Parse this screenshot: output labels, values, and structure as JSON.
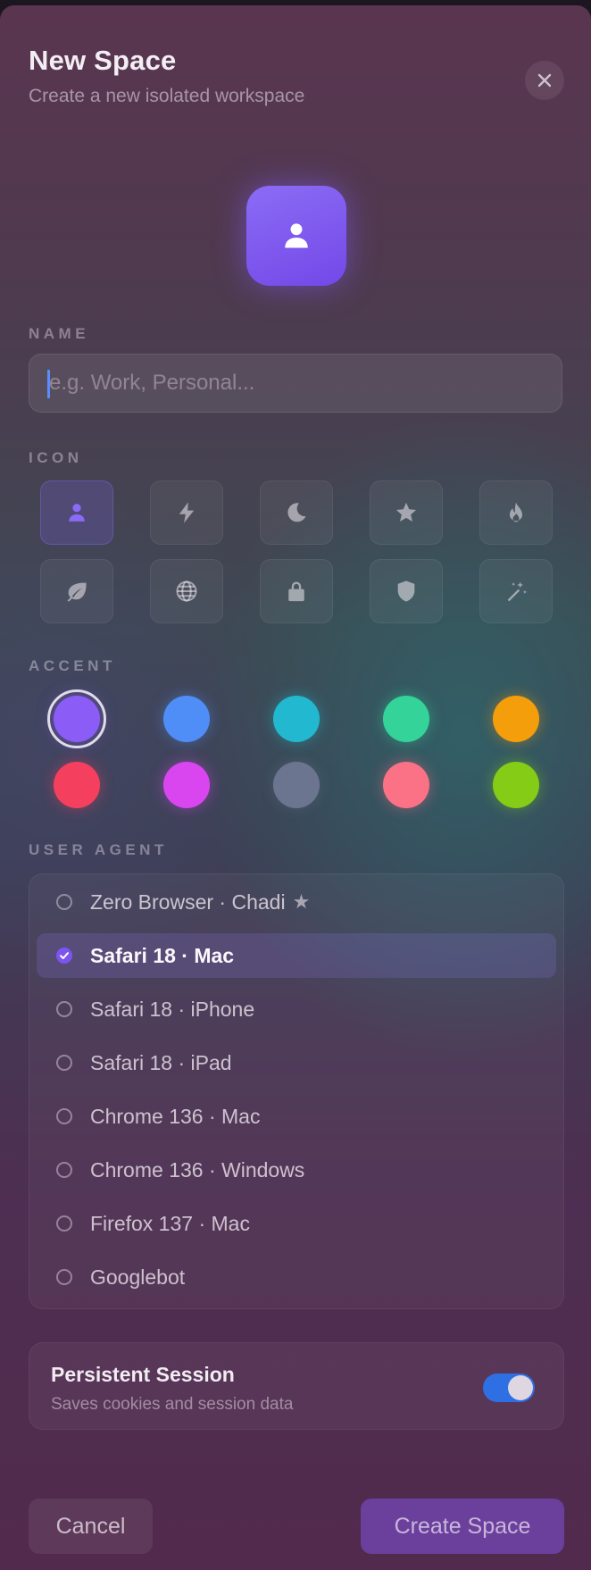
{
  "header": {
    "title": "New Space",
    "subtitle": "Create a new isolated workspace"
  },
  "name_section": {
    "label": "NAME",
    "placeholder": "e.g. Work, Personal...",
    "value": ""
  },
  "icon_section": {
    "label": "ICON",
    "selected": "person-icon",
    "icons": [
      "person-icon",
      "bolt-icon",
      "moon-icon",
      "star-icon",
      "flame-icon",
      "leaf-icon",
      "globe-icon",
      "lock-icon",
      "shield-icon",
      "magic-wand-icon"
    ]
  },
  "accent_section": {
    "label": "ACCENT",
    "selected": "#8b5cf6",
    "colors": [
      "#8b5cf6",
      "#4f8ef7",
      "#22b8cf",
      "#34d399",
      "#f59e0b",
      "#f43f5e",
      "#d946ef",
      "#6b7590",
      "#fb7185",
      "#84cc16"
    ]
  },
  "user_agent_section": {
    "label": "USER AGENT",
    "options": [
      {
        "label": "Zero Browser · Chadi",
        "starred": true,
        "selected": false
      },
      {
        "label": "Safari 18 · Mac",
        "starred": false,
        "selected": true
      },
      {
        "label": "Safari 18 · iPhone",
        "starred": false,
        "selected": false
      },
      {
        "label": "Safari 18 · iPad",
        "starred": false,
        "selected": false
      },
      {
        "label": "Chrome 136 · Mac",
        "starred": false,
        "selected": false
      },
      {
        "label": "Chrome 136 · Windows",
        "starred": false,
        "selected": false
      },
      {
        "label": "Firefox 137 · Mac",
        "starred": false,
        "selected": false
      },
      {
        "label": "Googlebot",
        "starred": false,
        "selected": false
      }
    ]
  },
  "persistent_session": {
    "title": "Persistent Session",
    "subtitle": "Saves cookies and session data",
    "enabled": true
  },
  "footer": {
    "cancel_label": "Cancel",
    "create_label": "Create Space"
  }
}
